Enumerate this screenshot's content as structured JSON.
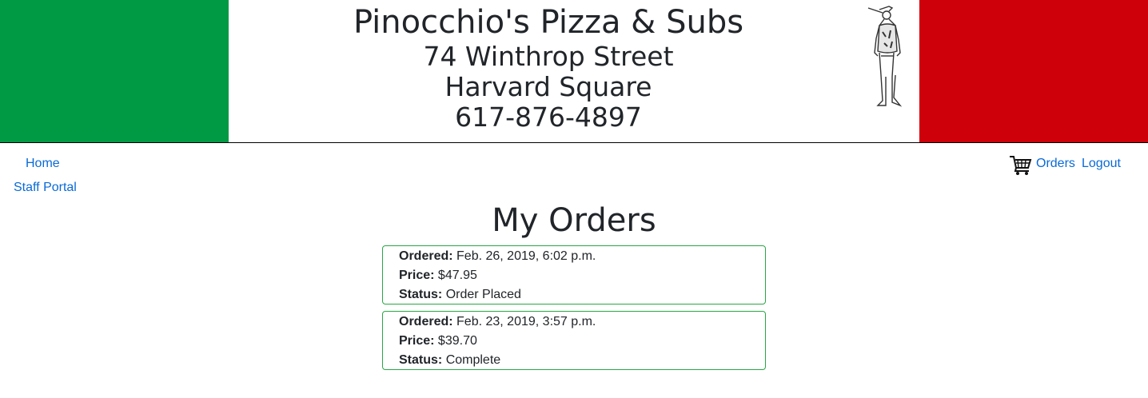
{
  "header": {
    "title": "Pinocchio's Pizza & Subs",
    "address_line1": "74 Winthrop Street",
    "address_line2": "Harvard Square",
    "phone": "617-876-4897",
    "colors": {
      "green": "#009a44",
      "white": "#ffffff",
      "red": "#ce000a"
    }
  },
  "nav": {
    "home": "Home",
    "staff_portal": "Staff Portal",
    "cart_icon": "shopping-cart-icon",
    "orders": "Orders",
    "logout": "Logout",
    "link_color": "#0a6ad6"
  },
  "page": {
    "title": "My Orders"
  },
  "orders": [
    {
      "ordered_label": "Ordered:",
      "ordered": "Feb. 26, 2019, 6:02 p.m.",
      "price_label": "Price:",
      "price": "$47.95",
      "status_label": "Status:",
      "status": "Order Placed"
    },
    {
      "ordered_label": "Ordered:",
      "ordered": "Feb. 23, 2019, 3:57 p.m.",
      "price_label": "Price:",
      "price": "$39.70",
      "status_label": "Status:",
      "status": "Complete"
    }
  ],
  "card_border_color": "#28a745"
}
